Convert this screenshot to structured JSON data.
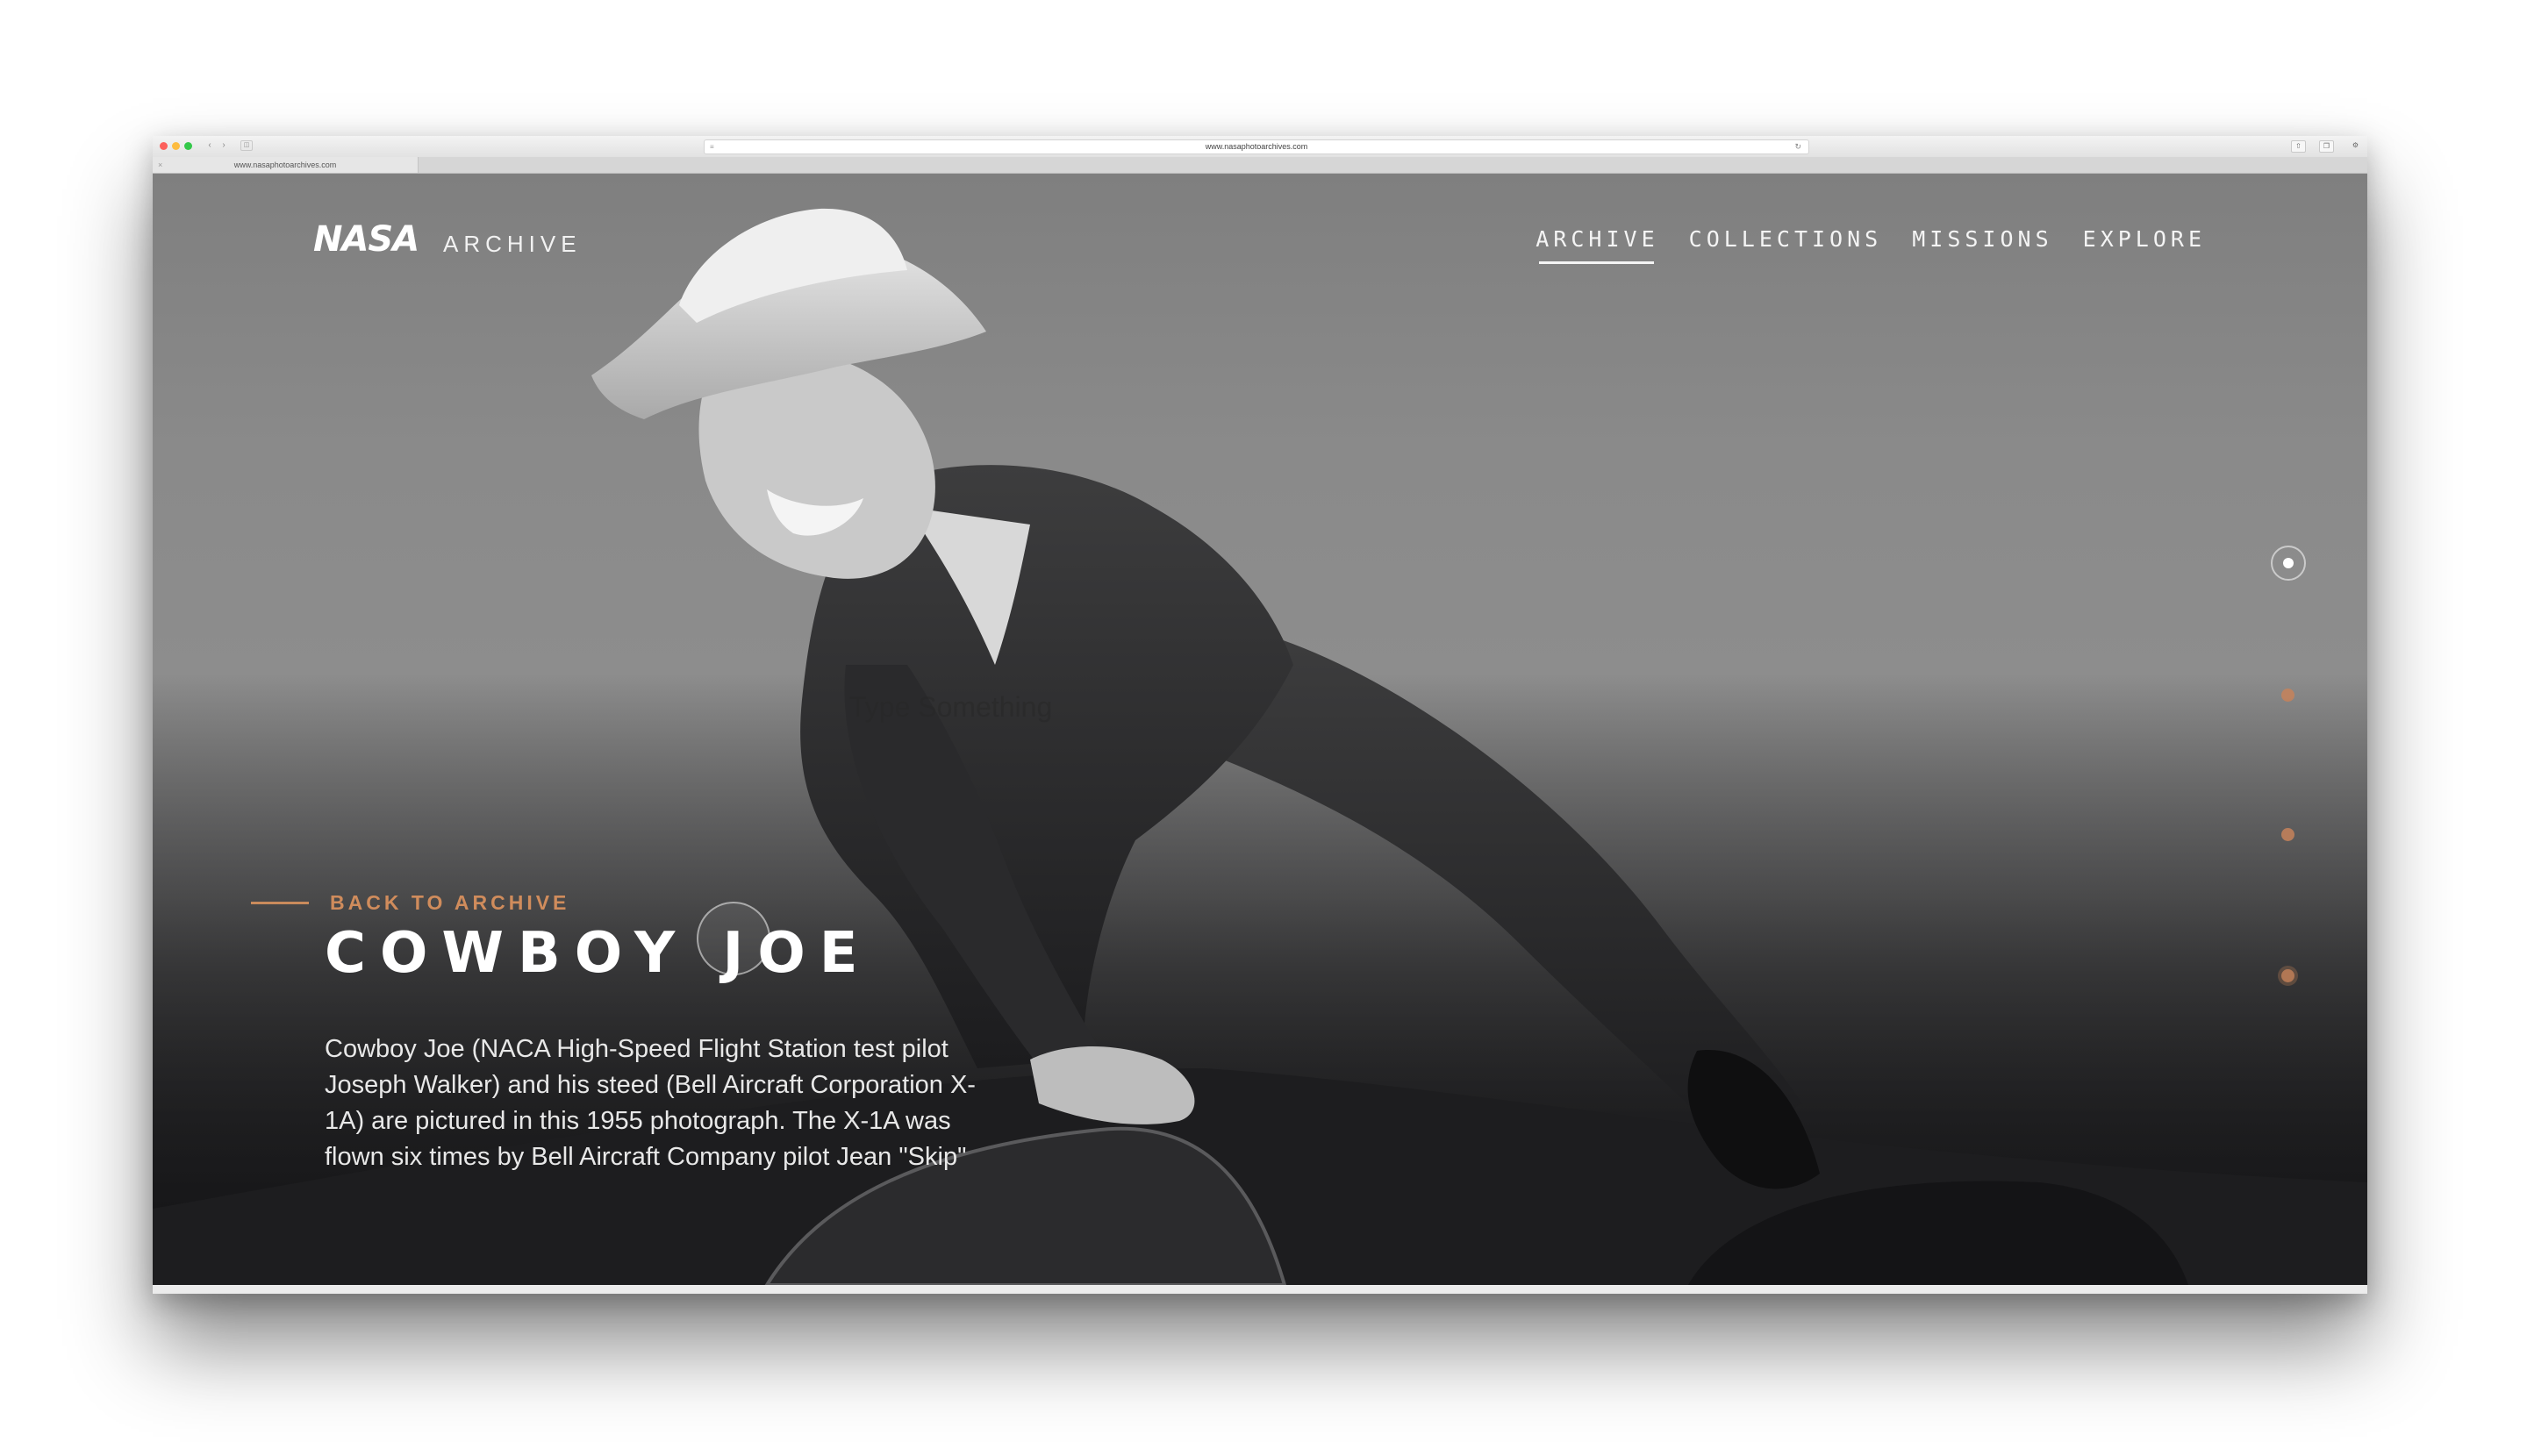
{
  "browser": {
    "url": "www.nasaphotoarchives.com",
    "tab_title": "www.nasaphotoarchives.com"
  },
  "header": {
    "logo_text": "NASA",
    "logo_sub": "ARCHIVE",
    "nav": [
      {
        "label": "ARCHIVE",
        "active": true
      },
      {
        "label": "COLLECTIONS",
        "active": false
      },
      {
        "label": "MISSIONS",
        "active": false
      },
      {
        "label": "EXPLORE",
        "active": false
      }
    ]
  },
  "hero": {
    "back_label": "BACK TO ARCHIVE",
    "title": "COWBOY JOE",
    "description": "Cowboy Joe (NACA High-Speed Flight Station test pilot Joseph Walker) and his steed (Bell Aircraft Corporation X-1A) are pictured in this 1955 photograph. The X-1A was flown six times by Bell Aircraft Company pilot Jean \"Skip\"",
    "ghost_text": "Type Something"
  },
  "pager": {
    "count": 4,
    "active_index": 0
  },
  "colors": {
    "accent": "#d08c5c",
    "text": "#ffffff"
  }
}
